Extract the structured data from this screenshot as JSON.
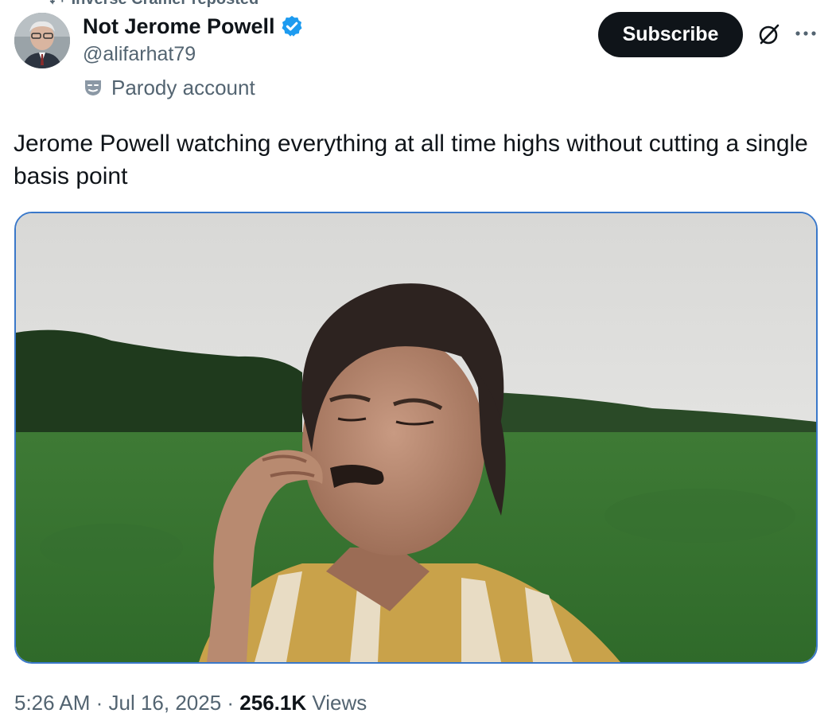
{
  "repost": {
    "label": "Inverse Cramer reposted"
  },
  "author": {
    "display_name": "Not Jerome Powell",
    "handle": "@alifarhat79",
    "verified": true,
    "label_icon": "mask-icon",
    "label": "Parody account"
  },
  "actions": {
    "subscribe_label": "Subscribe",
    "grok_icon": "grok-icon",
    "more_icon": "more-icon"
  },
  "tweet": {
    "text": "Jerome Powell watching everything at all time highs without cutting a single basis point"
  },
  "media": {
    "kind": "video-gif"
  },
  "meta": {
    "time": "5:26 AM",
    "separator": " · ",
    "date": "Jul 16, 2025",
    "views_count": "256.1K",
    "views_label": " Views"
  },
  "colors": {
    "text_primary": "#0f1419",
    "text_secondary": "#536471",
    "verified_blue": "#1d9bf0",
    "media_border": "#3a78c9"
  }
}
